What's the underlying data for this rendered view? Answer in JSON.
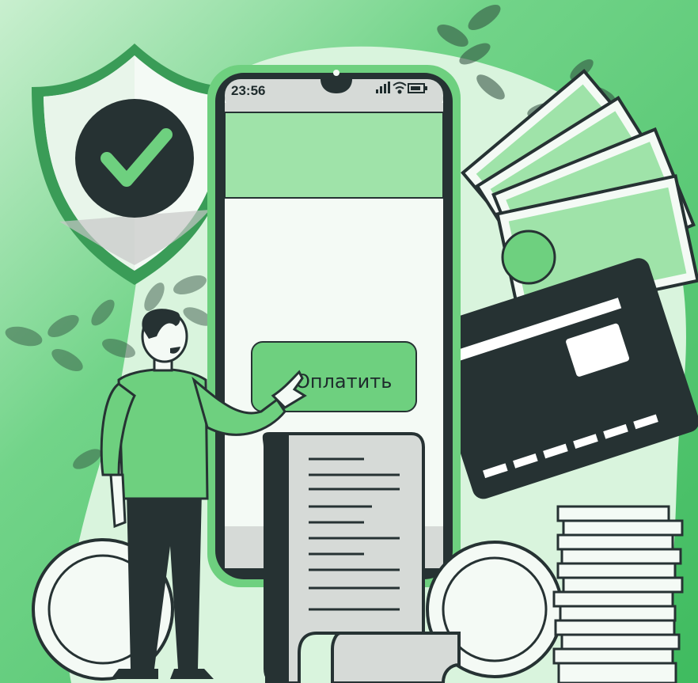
{
  "phone": {
    "status_time": "23:56",
    "pay_button_label": "Оплатить"
  },
  "colors": {
    "background_green": "#49c36b",
    "light_green": "#9fe3a9",
    "pale_green": "#d8f3dc",
    "dark": "#263233",
    "accent": "#6ed07f"
  },
  "icons": [
    "shield-check-icon",
    "signal-icon",
    "wifi-icon",
    "battery-icon",
    "wallet-card-icon",
    "receipt-icon",
    "coin-icon",
    "banknote-icon"
  ]
}
